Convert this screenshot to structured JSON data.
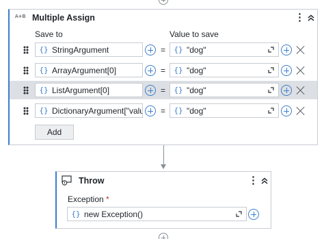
{
  "assign": {
    "icon_label": "A+B",
    "title": "Multiple Assign",
    "more_label": "⋮",
    "col_save_to": "Save to",
    "col_value": "Value to save",
    "eq_sign": "=",
    "brace": "{}",
    "add_label": "Add",
    "rows": [
      {
        "save_to": "StringArgument",
        "value": "\"dog\""
      },
      {
        "save_to": "ArrayArgument[0]",
        "value": "\"dog\""
      },
      {
        "save_to": "ListArgument[0]",
        "value": "\"dog\"",
        "selected": true
      },
      {
        "save_to": "DictionaryArgument[\"valu",
        "value": "\"dog\""
      }
    ]
  },
  "throw": {
    "title": "Throw",
    "more_label": "⋮",
    "exception_label": "Exception",
    "required_mark": "*",
    "brace": "{}",
    "exception_value": "new Exception()"
  },
  "colors": {
    "accent": "#3b7ecc",
    "selected_row": "#dcdfe3",
    "border": "#c7cbd1"
  }
}
